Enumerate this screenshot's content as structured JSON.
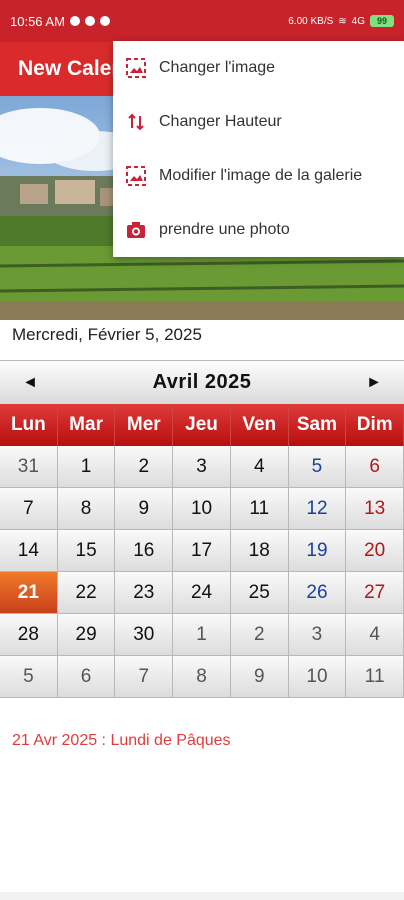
{
  "status_bar": {
    "time": "10:56 AM",
    "speed": "6.00 KB/S",
    "signal": "4G",
    "battery": "99"
  },
  "app_bar": {
    "title": "New Calendar"
  },
  "menu": {
    "items": [
      {
        "label": "Changer l'image",
        "icon": "image-icon"
      },
      {
        "label": "Changer Hauteur",
        "icon": "swap-vertical-icon"
      },
      {
        "label": "Modifier l'image de la galerie",
        "icon": "gallery-image-icon"
      },
      {
        "label": "prendre une photo",
        "icon": "camera-icon"
      }
    ]
  },
  "current_date": "Mercredi, Février 5, 2025",
  "calendar": {
    "month_label": "Avril  2025",
    "prev_symbol": "◄",
    "next_symbol": "►",
    "weekdays": [
      "Lun",
      "Mar",
      "Mer",
      "Jeu",
      "Ven",
      "Sam",
      "Dim"
    ],
    "weeks": [
      [
        "31",
        "1",
        "2",
        "3",
        "4",
        "5",
        "6"
      ],
      [
        "7",
        "8",
        "9",
        "10",
        "11",
        "12",
        "13"
      ],
      [
        "14",
        "15",
        "16",
        "17",
        "18",
        "19",
        "20"
      ],
      [
        "21",
        "22",
        "23",
        "24",
        "25",
        "26",
        "27"
      ],
      [
        "28",
        "29",
        "30",
        "1",
        "2",
        "3",
        "4"
      ],
      [
        "5",
        "6",
        "7",
        "8",
        "9",
        "10",
        "11"
      ]
    ]
  },
  "holiday_note": "21 Avr 2025 : Lundi de Pâques",
  "colors": {
    "accent": "#d92b2b",
    "today": "#e0552a",
    "weekend_sat": "#1a3fa0",
    "weekend_sun": "#b01818"
  }
}
